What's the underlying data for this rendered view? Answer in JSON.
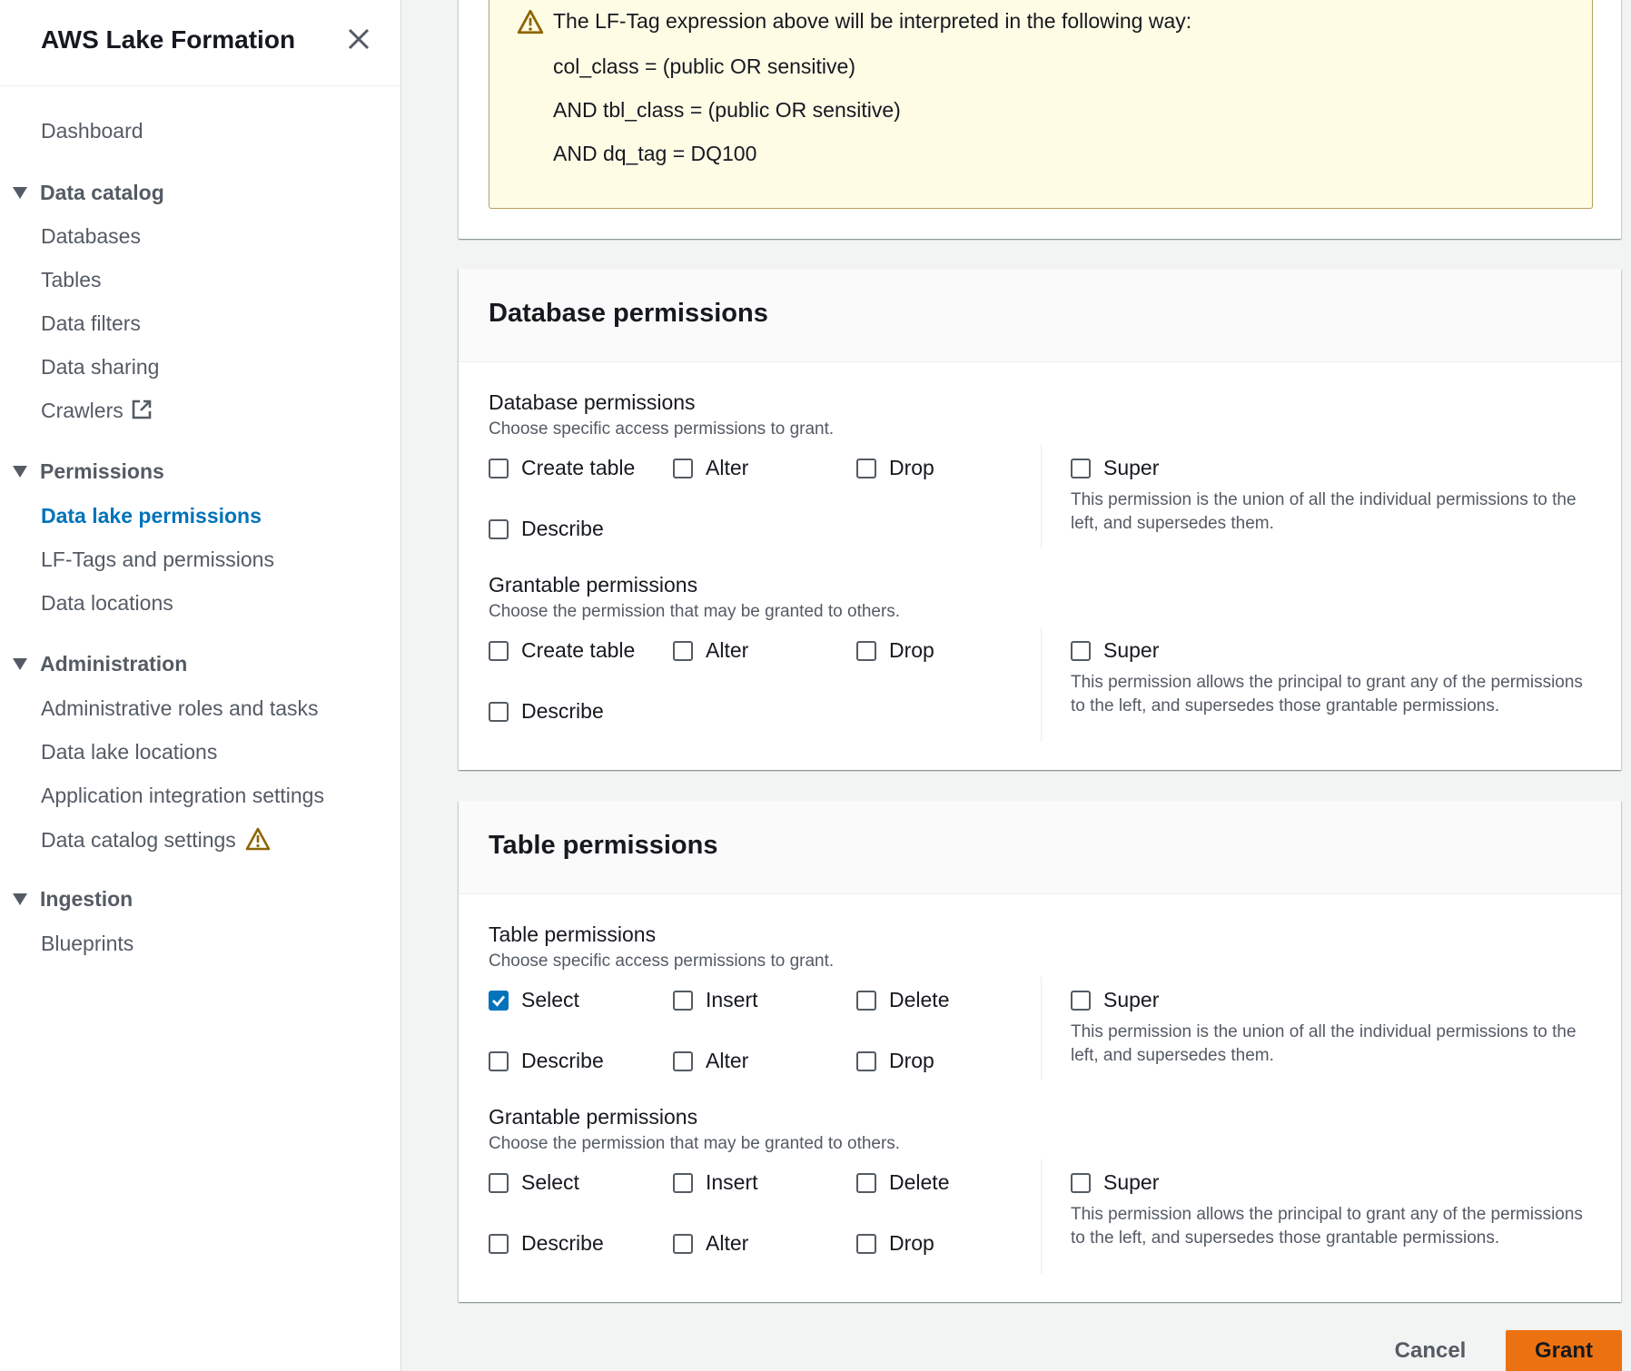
{
  "sidebar": {
    "title": "AWS Lake Formation",
    "dashboard": "Dashboard",
    "sections": {
      "data_catalog": {
        "label": "Data catalog",
        "items": [
          "Databases",
          "Tables",
          "Data filters",
          "Data sharing",
          "Crawlers"
        ]
      },
      "permissions": {
        "label": "Permissions",
        "items": [
          "Data lake permissions",
          "LF-Tags and permissions",
          "Data locations"
        ]
      },
      "administration": {
        "label": "Administration",
        "items": [
          "Administrative roles and tasks",
          "Data lake locations",
          "Application integration settings",
          "Data catalog settings"
        ]
      },
      "ingestion": {
        "label": "Ingestion",
        "items": [
          "Blueprints"
        ]
      }
    },
    "active_item": "Data lake permissions"
  },
  "alert": {
    "heading": "The LF-Tag expression above will be interpreted in the following way:",
    "lines": [
      "col_class = (public OR sensitive)",
      "AND tbl_class = (public OR sensitive)",
      "AND dq_tag = DQ100"
    ]
  },
  "database_panel": {
    "title": "Database permissions",
    "perm": {
      "title": "Database permissions",
      "desc": "Choose specific access permissions to grant.",
      "options": [
        "Create table",
        "Alter",
        "Drop",
        "Describe"
      ],
      "super_label": "Super",
      "super_desc": "This permission is the union of all the individual permissions to the left, and supersedes them."
    },
    "grant": {
      "title": "Grantable permissions",
      "desc": "Choose the permission that may be granted to others.",
      "options": [
        "Create table",
        "Alter",
        "Drop",
        "Describe"
      ],
      "super_label": "Super",
      "super_desc": "This permission allows the principal to grant any of the permissions to the left, and supersedes those grantable permissions."
    }
  },
  "table_panel": {
    "title": "Table permissions",
    "perm": {
      "title": "Table permissions",
      "desc": "Choose specific access permissions to grant.",
      "options": [
        "Select",
        "Insert",
        "Delete",
        "Describe",
        "Alter",
        "Drop"
      ],
      "checked": [
        "Select"
      ],
      "super_label": "Super",
      "super_desc": "This permission is the union of all the individual permissions to the left, and supersedes them."
    },
    "grant": {
      "title": "Grantable permissions",
      "desc": "Choose the permission that may be granted to others.",
      "options": [
        "Select",
        "Insert",
        "Delete",
        "Describe",
        "Alter",
        "Drop"
      ],
      "super_label": "Super",
      "super_desc": "This permission allows the principal to grant any of the permissions to the left, and supersedes those grantable permissions."
    }
  },
  "footer": {
    "cancel": "Cancel",
    "grant": "Grant"
  },
  "colors": {
    "accent": "#0073bb",
    "primary_button": "#ec7211",
    "alert_bg": "#fffce6",
    "warning": "#8d6605"
  }
}
